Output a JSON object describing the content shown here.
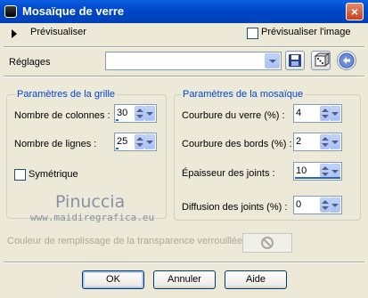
{
  "window": {
    "title": "Mosaïque de verre",
    "close_label": "×"
  },
  "preview": {
    "toggle_label": "Prévisualiser",
    "checkbox_label": "Prévisualiser l'image"
  },
  "presets": {
    "label": "Réglages",
    "value": ""
  },
  "grid": {
    "title": "Paramètres de la grille",
    "columns_label": "Nombre de colonnes :",
    "columns_value": "30",
    "rows_label": "Nombre de lignes :",
    "rows_value": "25",
    "symmetric_label": "Symétrique"
  },
  "mosaic": {
    "title": "Paramètres de la mosaïque",
    "curvature_label": "Courbure du verre (%) :",
    "curvature_value": "4",
    "edge_label": "Courbure des bords (%) :",
    "edge_value": "2",
    "joint_thickness_label": "Épaisseur des joints :",
    "joint_thickness_value": "10",
    "joint_diffusion_label": "Diffusion des joints (%) :",
    "joint_diffusion_value": "0"
  },
  "fill_color_label": "Couleur de remplissage de la transparence verrouillée :",
  "watermark": {
    "name": "Pinuccia",
    "url": "www.maidiregrafica.eu"
  },
  "buttons": {
    "ok": "OK",
    "cancel": "Annuler",
    "help": "Aide"
  },
  "icons": {
    "save": "save-icon",
    "randomize": "dice-icon",
    "reset": "reset-icon"
  },
  "colors": {
    "title_bar": "#0046C8",
    "group_title": "#0046D5",
    "dialog_bg": "#ECE9D8"
  }
}
